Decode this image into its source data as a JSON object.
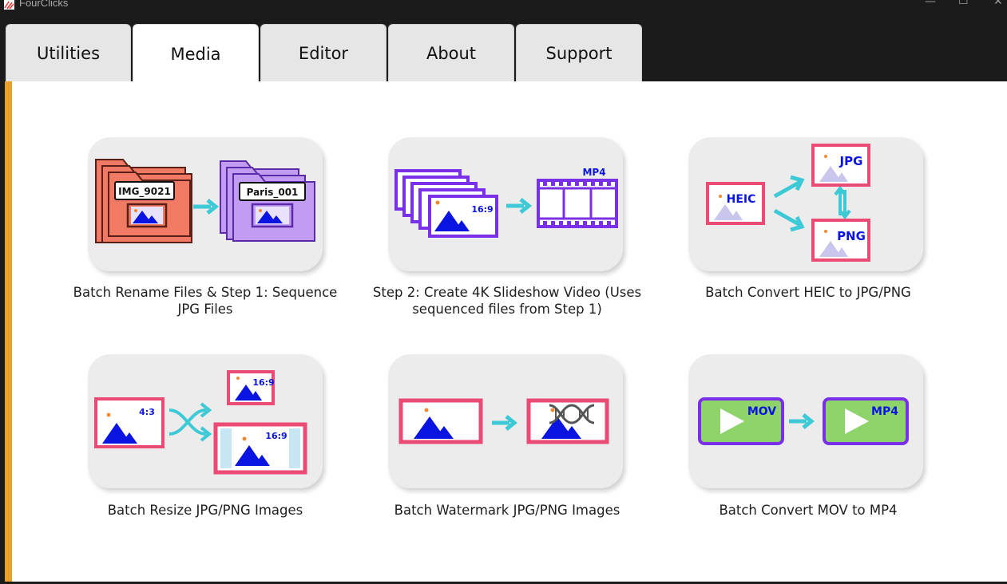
{
  "window": {
    "title": "FourClicks",
    "controls": {
      "minimize": "—",
      "maximize": "☐",
      "close": "✕"
    }
  },
  "tabs": [
    {
      "label": "Utilities",
      "active": false
    },
    {
      "label": "Media",
      "active": true
    },
    {
      "label": "Editor",
      "active": false
    },
    {
      "label": "About",
      "active": false
    },
    {
      "label": "Support",
      "active": false
    }
  ],
  "tools": [
    {
      "label_line1": "Batch Rename Files & Step 1: Sequence",
      "label_line2": "JPG Files",
      "icon": "folder-rename-icon",
      "before_name": "IMG_9021",
      "after_name": "Paris_001"
    },
    {
      "label_line1": "Step 2: Create 4K Slideshow Video (Uses",
      "label_line2": "sequenced files from Step 1)",
      "icon": "slideshow-video-icon",
      "aspect": "16:9",
      "format": "MP4"
    },
    {
      "label_line1": "Batch Convert HEIC to JPG/PNG",
      "label_line2": "",
      "icon": "heic-convert-icon",
      "source": "HEIC",
      "target1": "JPG",
      "target2": "PNG"
    },
    {
      "label_line1": "Batch Resize JPG/PNG Images",
      "label_line2": "",
      "icon": "resize-image-icon",
      "source_ratio": "4:3",
      "target_ratio1": "16:9",
      "target_ratio2": "16:9"
    },
    {
      "label_line1": "Batch Watermark JPG/PNG Images",
      "label_line2": "",
      "icon": "watermark-image-icon"
    },
    {
      "label_line1": "Batch Convert MOV to MP4",
      "label_line2": "",
      "icon": "mov-to-mp4-icon",
      "source": "MOV",
      "target": "MP4"
    }
  ],
  "colors": {
    "accent": "#e9a02b",
    "arrow": "#3ec9d6",
    "pink": "#ea4a74",
    "purple": "#8a3ee6",
    "blue": "#0a14e0",
    "green": "#8fd46a"
  }
}
